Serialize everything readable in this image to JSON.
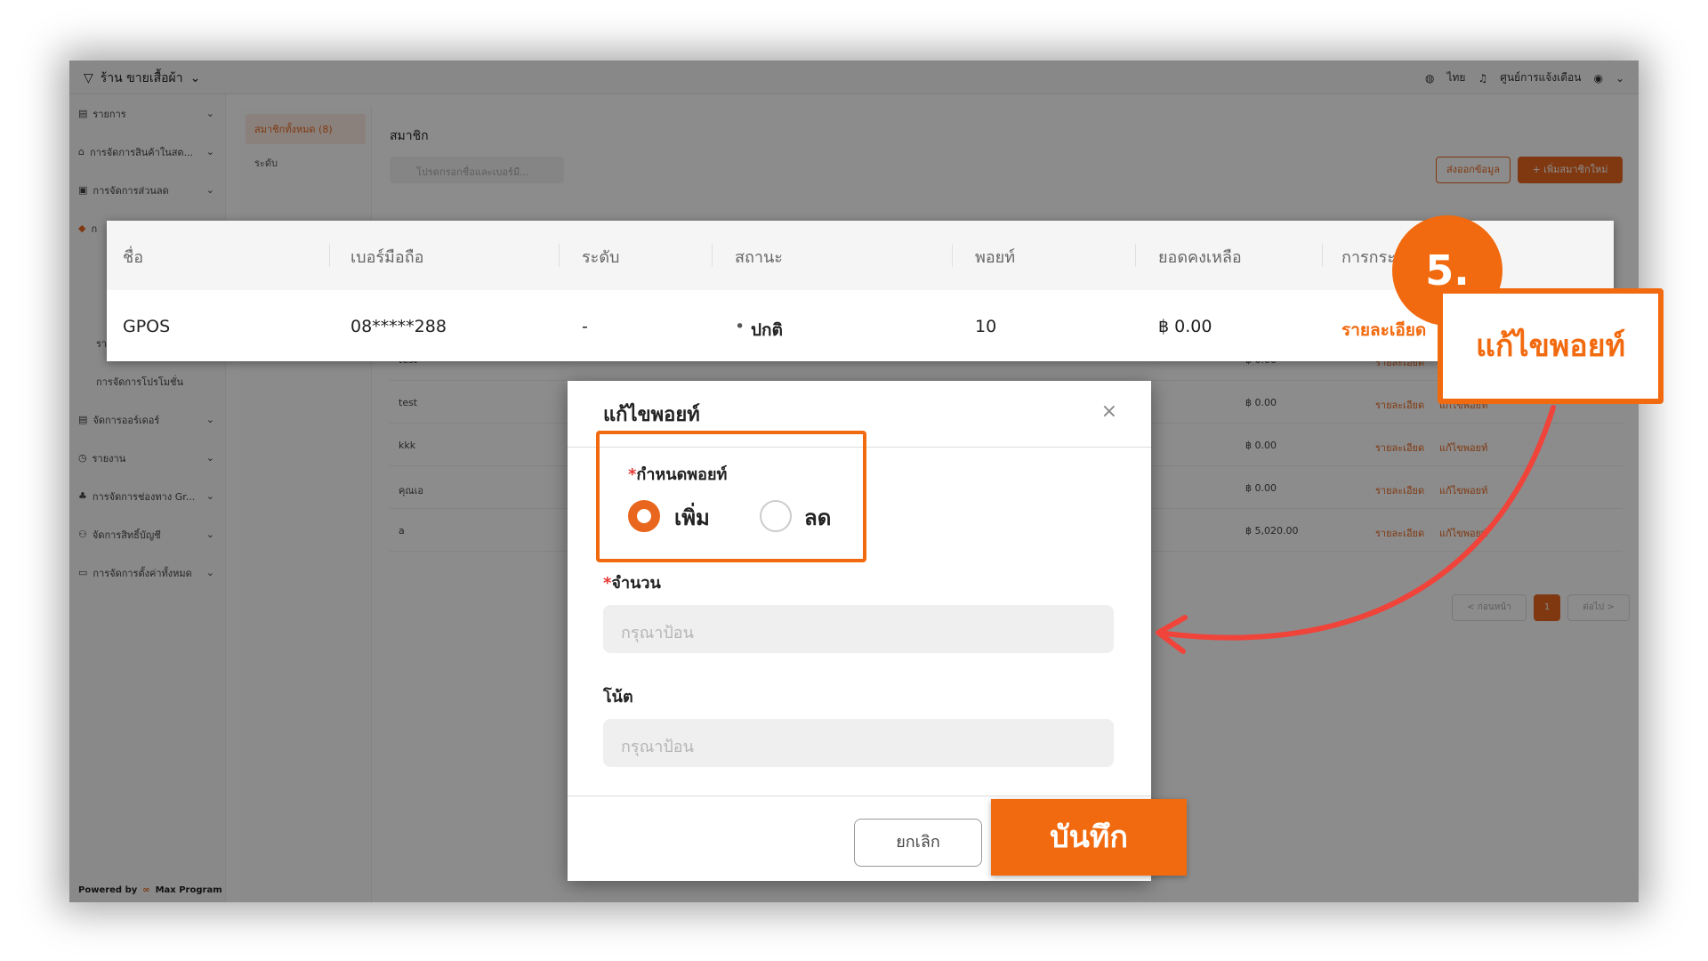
{
  "topbar": {
    "store_name": "ร้าน ขายเสื้อผ้า",
    "language": "ไทย",
    "notifications": "ศูนย์การแจ้งเตือน"
  },
  "sidebar": {
    "items": [
      {
        "label": "รายการ"
      },
      {
        "label": "การจัดการสินค้าในสต..."
      },
      {
        "label": "การจัดการส่วนลด"
      },
      {
        "label": "ก"
      }
    ],
    "subitems": [
      {
        "label": "รายละเอียดส่วนลด"
      },
      {
        "label": "การจัดการโปรโมชั่น"
      }
    ],
    "items_bottom": [
      {
        "label": "จัดการออร์เดอร์"
      },
      {
        "label": "รายงาน"
      },
      {
        "label": "การจัดการช่องทาง Gr..."
      },
      {
        "label": "จัดการสิทธิ์บัญชี"
      },
      {
        "label": "การจัดการตั้งค่าทั้งหมด"
      }
    ],
    "powered_by": "Powered by",
    "brand": "Max Program"
  },
  "submenu": {
    "active": "สมาชิกทั้งหมด (8)",
    "level": "ระดับ"
  },
  "main": {
    "title": "สมาชิก",
    "search_placeholder": "โปรดกรอกชื่อและเบอร์มื...",
    "export_label": "ส่งออกข้อมูล",
    "add_label": "+ เพิ่มสมาชิกใหม่"
  },
  "bg_rows": [
    {
      "name": "test",
      "balance": "฿ 0.00",
      "detail": "รายละเอียด",
      "edit": "แก้ไขพอยท์"
    },
    {
      "name": "test",
      "balance": "฿ 0.00",
      "detail": "รายละเอียด",
      "edit": "แก้ไขพอยท์"
    },
    {
      "name": "kkk",
      "balance": "฿ 0.00",
      "detail": "รายละเอียด",
      "edit": "แก้ไขพอยท์"
    },
    {
      "name": "คุณเอ",
      "balance": "฿ 0.00",
      "detail": "รายละเอียด",
      "edit": "แก้ไขพอยท์"
    },
    {
      "name": "a",
      "balance": "฿ 5,020.00",
      "detail": "รายละเอียด",
      "edit": "แก้ไขพอยท์"
    }
  ],
  "pager": {
    "prev": "< ก่อนหน้า",
    "page": "1",
    "next": "ต่อไป >"
  },
  "zoom_table": {
    "headers": [
      "ชื่อ",
      "เบอร์มือถือ",
      "ระดับ",
      "สถานะ",
      "พอยท์",
      "ยอดคงเหลือ",
      "การกระ"
    ],
    "row": {
      "name": "GPOS",
      "phone": "08*****288",
      "level": "-",
      "status": "ปกติ",
      "points": "10",
      "balance": "฿ 0.00",
      "action": "รายละเอียด"
    }
  },
  "dialog": {
    "title": "แก้ไขพอยท์",
    "close": "×",
    "points_label": "กำหนดพอยท์",
    "required_mark": "*",
    "option_add": "เพิ่ม",
    "option_reduce": "ลด",
    "amount_label": "จำนวน",
    "amount_placeholder": "กรุณาป้อน",
    "note_label": "โน้ต",
    "note_placeholder": "กรุณาป้อน",
    "cancel": "ยกเลิก",
    "save": "บันทึก"
  },
  "annotation": {
    "step": "5.",
    "callout": "แก้ไขพอยท์"
  },
  "colors": {
    "accent": "#f26a0f",
    "arrow": "#f0433a"
  }
}
